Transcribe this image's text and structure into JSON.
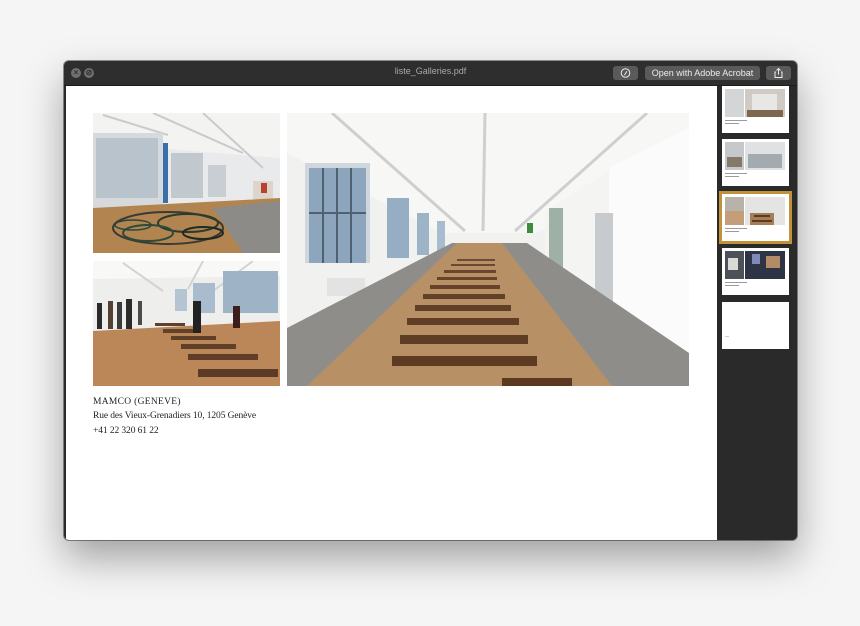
{
  "window": {
    "title": "liste_Galleries.pdf",
    "open_with_label": "Open with Adobe Acrobat"
  },
  "toolbar": {
    "close_icon": "close-icon",
    "fullscreen_icon": "no-entry-icon",
    "annotate_icon": "markup-pen-icon",
    "share_icon": "share-icon"
  },
  "document": {
    "gallery_name": "MAMCO (GENEVE)",
    "address": "Rue des Vieux-Grenadiers 10, 1205 Genève",
    "phone": "+41 22 320 61 22"
  },
  "sidebar": {
    "page_count": 5,
    "selected_page": 3
  },
  "colors": {
    "selection": "#c2923a",
    "window_chrome": "#2e2e2e",
    "button": "#5a5a5a"
  }
}
